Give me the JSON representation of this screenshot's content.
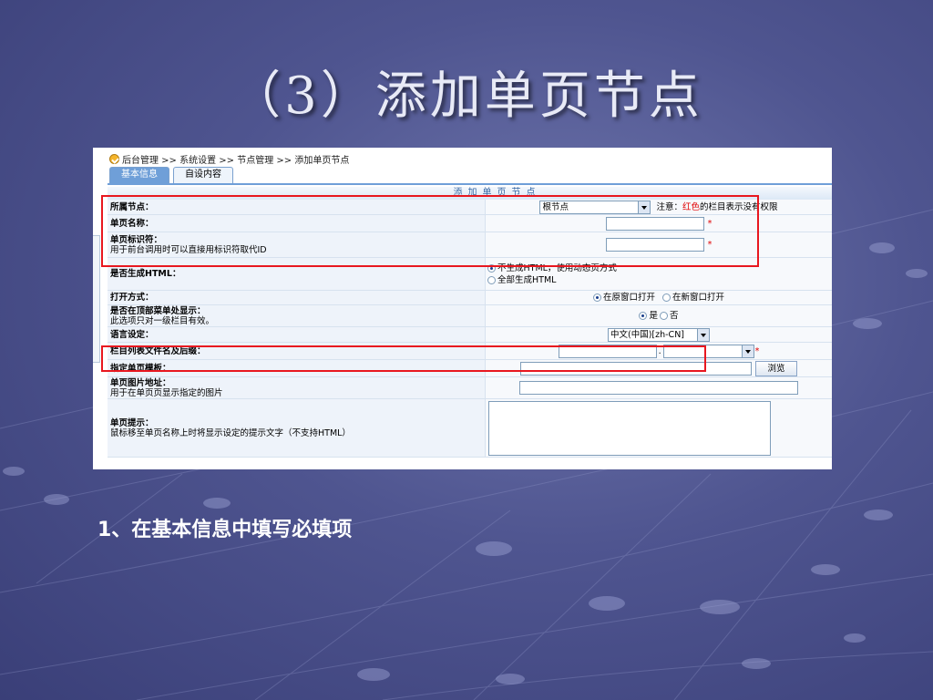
{
  "slide": {
    "title": "（3）添加单页节点",
    "caption": "1、在基本信息中填写必填项"
  },
  "breadcrumb": "后台管理 >> 系统设置 >> 节点管理 >> 添加单页节点",
  "tabs": [
    {
      "label": "基本信息",
      "active": true
    },
    {
      "label": "自设内容",
      "active": false
    }
  ],
  "section_title": "添加单页节点",
  "form": {
    "parent_node": {
      "label": "所属节点：",
      "value": "根节点",
      "note_prefix": "注意：",
      "note_red": "红色",
      "note_suffix": "的栏目表示没有权限"
    },
    "page_name": {
      "label": "单页名称：",
      "required": "*"
    },
    "page_identifier": {
      "label": "单页标识符：",
      "hint": "用于前台调用时可以直接用标识符取代ID",
      "required": "*"
    },
    "generate_html": {
      "label": "是否生成HTML：",
      "options": [
        "不生成HTML，使用动态页方式",
        "全部生成HTML"
      ],
      "selected": 0
    },
    "open_mode": {
      "label": "打开方式：",
      "options": [
        "在原窗口打开",
        "在新窗口打开"
      ],
      "selected": 0
    },
    "top_menu": {
      "label": "是否在顶部菜单处显示：",
      "hint": "此选项只对一级栏目有效。",
      "options": [
        "是",
        "否"
      ],
      "selected": 0
    },
    "language": {
      "label": "语言设定：",
      "value": "中文(中国)[zh-CN]"
    },
    "list_filename": {
      "label": "栏目列表文件名及后缀：",
      "separator": ".",
      "required": "*"
    },
    "template": {
      "label": "指定单页模板：",
      "button": "浏览"
    },
    "image_url": {
      "label": "单页图片地址：",
      "hint": "用于在单页页显示指定的图片"
    },
    "page_tip": {
      "label": "单页提示：",
      "hint": "鼠标移至单页名称上时将显示设定的提示文字（不支持HTML）"
    }
  },
  "colors": {
    "highlight": "#e8171f",
    "tab_active": "#6f9fd8",
    "required": "#e00000"
  }
}
